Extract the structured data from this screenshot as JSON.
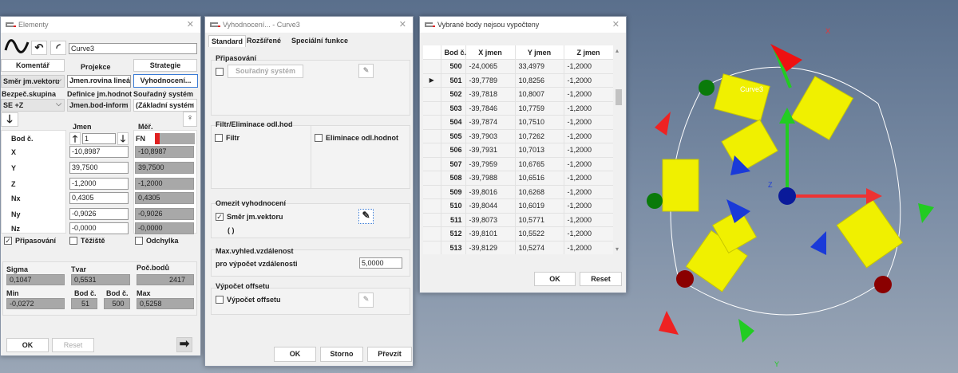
{
  "elementy": {
    "title": "Elementy",
    "name": "Curve3",
    "komentar": "Komentář",
    "projekce": "Projekce",
    "strategie": "Strategie",
    "smer": "Směr jm.vektoru",
    "rovina": "Jmen.rovina lineárně",
    "vyhodnoceni": "Vyhodnocení...",
    "bezpec": "Bezpeč.skupina",
    "definice": "Definice jm.hodnot",
    "soursys": "Souřadný systém",
    "bezpec_val": "SE +Z",
    "definice_val": "Jmen.bod-inform",
    "soursys_val": "(Základní systém",
    "jmen": "Jmen",
    "mer": "Měř.",
    "bod": "Bod č.",
    "bod_val": "1",
    "fn": "FN",
    "rows": [
      {
        "l": "X",
        "j": "-10,8987",
        "m": "-10,8987"
      },
      {
        "l": "Y",
        "j": "39,7500",
        "m": "39,7500"
      },
      {
        "l": "Z",
        "j": "-1,2000",
        "m": "-1,2000"
      },
      {
        "l": "Nx",
        "j": "0,4305",
        "m": "0,4305"
      },
      {
        "l": "Ny",
        "j": "-0,9026",
        "m": "-0,9026"
      },
      {
        "l": "Nz",
        "j": "-0,0000",
        "m": "-0,0000"
      }
    ],
    "pripasovani": "Připasování",
    "teziste": "Těžiště",
    "odchylka": "Odchylka",
    "sigma": "Sigma",
    "sigma_val": "0,1047",
    "tvar": "Tvar",
    "tvar_val": "0,5531",
    "pocbodu": "Poč.bodů",
    "pocbodu_val": "2417",
    "min": "Min",
    "min_val": "-0,0272",
    "bod1": "Bod č.",
    "bod1_val": "51",
    "bod2": "Bod č.",
    "bod2_val": "500",
    "max": "Max",
    "max_val": "0,5258",
    "ok": "OK",
    "reset": "Reset"
  },
  "vyh": {
    "title": "Vyhodnocení... - Curve3",
    "tabs": [
      "Standard",
      "Rozšířené",
      "Speciální funkce"
    ],
    "g1": "Připasování",
    "soursys": "Souřadný systém",
    "g2": "Filtr/Eliminace odl.hod",
    "filtr": "Filtr",
    "elim": "Eliminace odl.hodnot",
    "g3": "Omezit vyhodnocení",
    "smer": "Směr jm.vektoru",
    "paren": "( )",
    "g4": "Max.vyhled.vzdálenost",
    "pro": "pro výpočet vzdálenosti",
    "pro_val": "5,0000",
    "g5": "Výpočet offsetu",
    "offset": "Výpočet offsetu",
    "ok": "OK",
    "storno": "Storno",
    "prevzit": "Převzít"
  },
  "body": {
    "title": "Vybrané body nejsou vypočteny",
    "headers": [
      "Bod č.",
      "X jmen",
      "Y jmen",
      "Z jmen"
    ],
    "rows": [
      [
        "500",
        "-24,0065",
        "33,4979",
        "-1,2000"
      ],
      [
        "501",
        "-39,7789",
        "10,8256",
        "-1,2000"
      ],
      [
        "502",
        "-39,7818",
        "10,8007",
        "-1,2000"
      ],
      [
        "503",
        "-39,7846",
        "10,7759",
        "-1,2000"
      ],
      [
        "504",
        "-39,7874",
        "10,7510",
        "-1,2000"
      ],
      [
        "505",
        "-39,7903",
        "10,7262",
        "-1,2000"
      ],
      [
        "506",
        "-39,7931",
        "10,7013",
        "-1,2000"
      ],
      [
        "507",
        "-39,7959",
        "10,6765",
        "-1,2000"
      ],
      [
        "508",
        "-39,7988",
        "10,6516",
        "-1,2000"
      ],
      [
        "509",
        "-39,8016",
        "10,6268",
        "-1,2000"
      ],
      [
        "510",
        "-39,8044",
        "10,6019",
        "-1,2000"
      ],
      [
        "511",
        "-39,8073",
        "10,5771",
        "-1,2000"
      ],
      [
        "512",
        "-39,8101",
        "10,5522",
        "-1,2000"
      ],
      [
        "513",
        "-39,8129",
        "10,5274",
        "-1,2000"
      ]
    ],
    "selected_row": 1,
    "ok": "OK",
    "reset": "Reset"
  },
  "scene": {
    "label": "Curve3",
    "axis_x": "X",
    "axis_y": "Y",
    "axis_z": "Z"
  }
}
